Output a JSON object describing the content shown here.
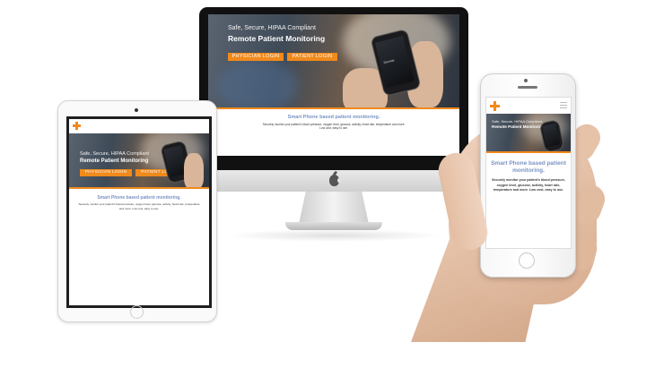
{
  "hero": {
    "subtitle": "Safe, Secure, HIPAA Compliant",
    "title": "Remote Patient Monitoring",
    "physician_login": "PHYSICIAN LOGIN",
    "patient_login": "PATIENT LOGIN",
    "phone_brand": "Remote"
  },
  "content": {
    "tagline": "Smart Phone based patient monitoring.",
    "description": "Securely monitor your patient's blood pressure, oxygen level, glucose, activity, heart rate, temperature and more. Low cost, easy to use.",
    "footer_note": "Low cost, easy to use."
  },
  "colors": {
    "accent": "#f08a1c",
    "tagline": "#7b93c4"
  },
  "icons": {
    "logo": "medical-cross-icon",
    "menu": "hamburger-menu-icon",
    "brand": "apple-logo-icon"
  }
}
